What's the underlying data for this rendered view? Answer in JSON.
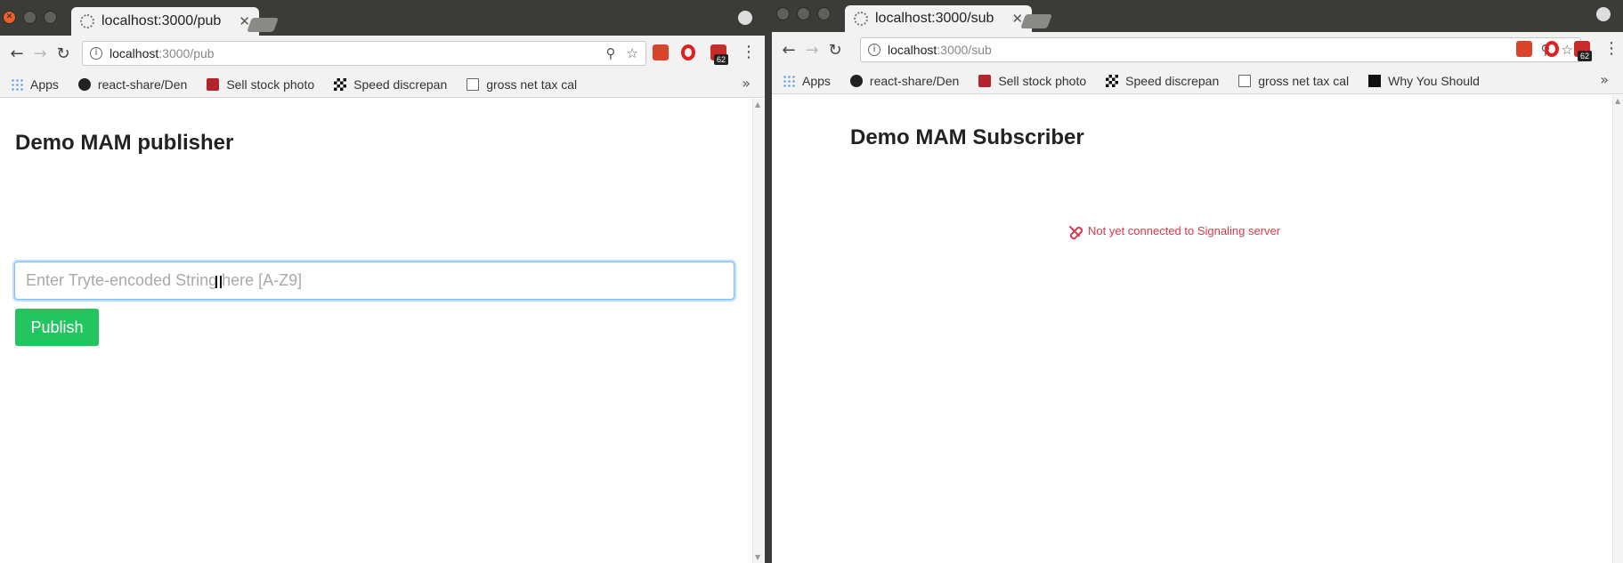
{
  "left": {
    "tab_title": "localhost:3000/pub",
    "url_host": "localhost",
    "url_path": ":3000/pub",
    "bookmarks": [
      "Apps",
      "react-share/Den",
      "Sell stock photo",
      "Speed discrepan",
      "gross net tax cal"
    ],
    "badge_count": "62",
    "page_title": "Demo MAM publisher",
    "input_placeholder": "Enter Tryte-encoded String here [A-Z9]",
    "publish_label": "Publish"
  },
  "right": {
    "tab_title": "localhost:3000/sub",
    "url_host": "localhost",
    "url_path": ":3000/sub",
    "bookmarks": [
      "Apps",
      "react-share/Den",
      "Sell stock photo",
      "Speed discrepan",
      "gross net tax cal",
      "Why You Should"
    ],
    "badge_count": "62",
    "page_title": "Demo MAM Subscriber",
    "status_text": "Not yet connected to Signaling server"
  },
  "colors": {
    "publish_button": "#22c55e",
    "status_error": "#e0354b",
    "focus_border": "#80bdff"
  }
}
